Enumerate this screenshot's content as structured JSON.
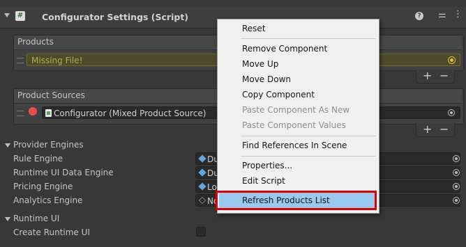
{
  "component": {
    "title": "Configurator Settings (Script)",
    "script_icon_glyph": "#"
  },
  "products": {
    "label": "Products",
    "missing_value": "Missing File!",
    "plus": "+",
    "minus": "−"
  },
  "product_sources": {
    "label": "Product Sources",
    "item_value": "Configurator (Mixed Product Source)",
    "plus": "+",
    "minus": "−"
  },
  "provider_engines": {
    "label": "Provider Engines",
    "rows": [
      {
        "label": "Rule Engine",
        "value": "Du",
        "icon": "cube-icon"
      },
      {
        "label": "Runtime UI Data Engine",
        "value": "Du",
        "icon": "cube-icon"
      },
      {
        "label": "Pricing Engine",
        "value": "Lo",
        "icon": "cube-icon"
      },
      {
        "label": "Analytics Engine",
        "value": "No",
        "icon": "cube-outline-icon"
      }
    ]
  },
  "runtime_ui": {
    "label": "Runtime UI",
    "create_label": "Create Runtime UI",
    "create_checked": false
  },
  "context_menu": {
    "items": [
      {
        "label": "Reset",
        "enabled": true
      },
      {
        "label": "Remove Component",
        "enabled": true
      },
      {
        "label": "Move Up",
        "enabled": true
      },
      {
        "label": "Move Down",
        "enabled": true
      },
      {
        "label": "Copy Component",
        "enabled": true
      },
      {
        "label": "Paste Component As New",
        "enabled": false
      },
      {
        "label": "Paste Component Values",
        "enabled": false
      },
      {
        "label": "Find References In Scene",
        "enabled": true
      },
      {
        "label": "Properties...",
        "enabled": true
      },
      {
        "label": "Edit Script",
        "enabled": true
      },
      {
        "label": "Refresh Products List",
        "enabled": true,
        "highlighted": true
      }
    ]
  },
  "colors": {
    "highlight": "#99c9ef",
    "annotation_frame": "#e00000",
    "missing_field_text": "#b3ae4e",
    "record_dot": "#ea4b4b"
  }
}
